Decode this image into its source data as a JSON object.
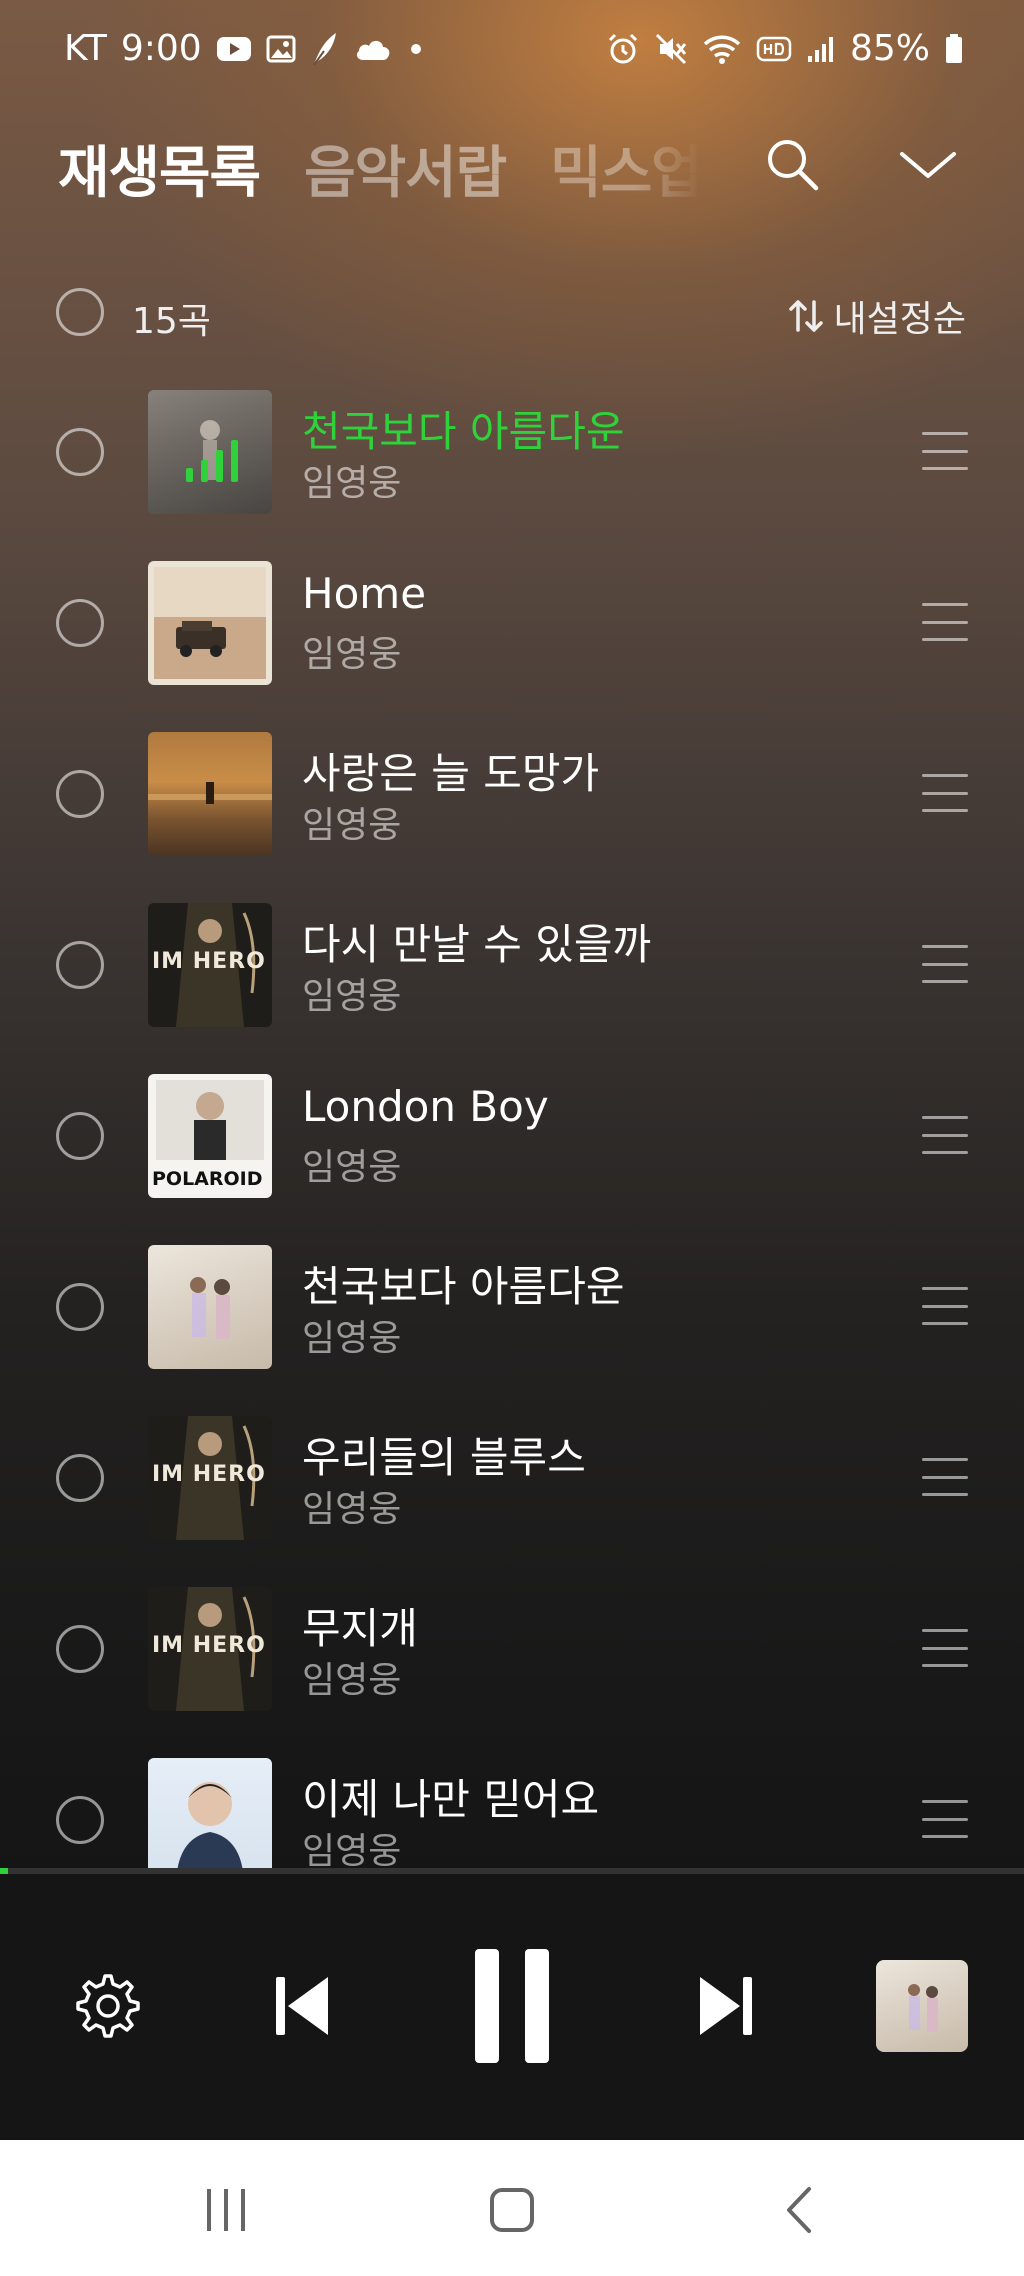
{
  "status_bar": {
    "carrier": "KT",
    "time": "9:00",
    "battery": "85%"
  },
  "header": {
    "tabs": [
      {
        "label": "재생목록",
        "active": true
      },
      {
        "label": "음악서랍",
        "active": false
      },
      {
        "label": "믹스업",
        "active": false
      }
    ]
  },
  "list_header": {
    "count": "15곡",
    "sort_label": "내설정순"
  },
  "songs": [
    {
      "title": "천국보다 아름다운",
      "artist": "임영웅",
      "playing": true
    },
    {
      "title": "Home",
      "artist": "임영웅"
    },
    {
      "title": "사랑은 늘 도망가",
      "artist": "임영웅"
    },
    {
      "title": "다시 만날 수 있을까",
      "artist": "임영웅"
    },
    {
      "title": "London Boy",
      "artist": "임영웅"
    },
    {
      "title": "천국보다 아름다운",
      "artist": "임영웅"
    },
    {
      "title": "우리들의 블루스",
      "artist": "임영웅"
    },
    {
      "title": "무지개",
      "artist": "임영웅"
    },
    {
      "title": "이제 나만 믿어요",
      "artist": "임영웅"
    }
  ],
  "album_art_text": {
    "im_hero": "IM HERO",
    "polaroid": "POLAROID"
  },
  "player": {
    "progress_fraction": 0.008,
    "state": "playing"
  },
  "colors": {
    "accent": "#2fd23a",
    "player_bg": "#151515",
    "nav_bg": "#ffffff"
  }
}
